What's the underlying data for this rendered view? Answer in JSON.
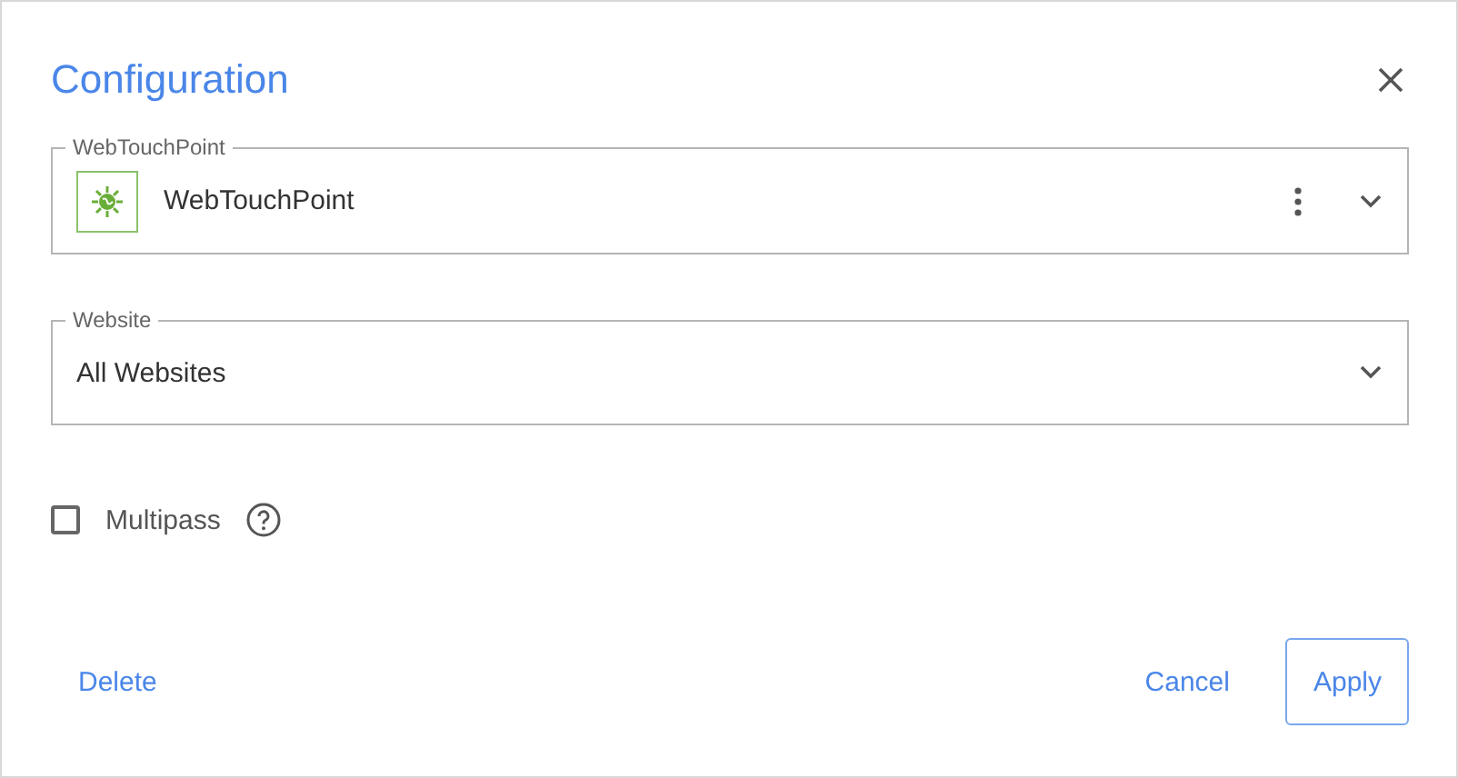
{
  "dialog": {
    "title": "Configuration"
  },
  "fields": [
    {
      "kind": "touchpoint",
      "label": "WebTouchPoint",
      "value": "WebTouchPoint"
    },
    {
      "kind": "select",
      "label": "Website",
      "value": "All Websites"
    }
  ],
  "multipass": {
    "label": "Multipass",
    "checked": false
  },
  "buttons": [
    {
      "label": "Delete",
      "kind": "text"
    },
    {
      "label": "Cancel",
      "kind": "text"
    },
    {
      "label": "Apply",
      "kind": "outlined"
    }
  ]
}
